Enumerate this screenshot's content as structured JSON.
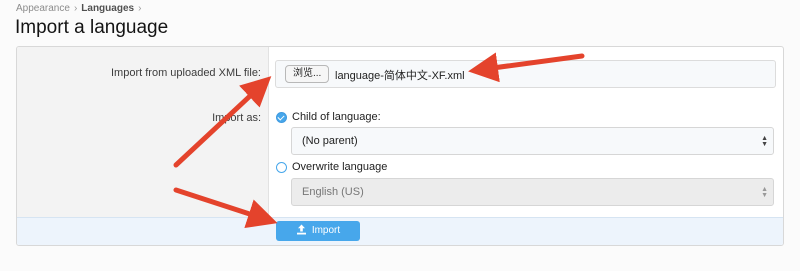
{
  "breadcrumb": {
    "items": [
      "Appearance",
      "Languages"
    ],
    "separator": "›"
  },
  "page": {
    "title": "Import a language"
  },
  "form": {
    "file_label": "Import from uploaded XML file:",
    "browse_label": "浏览...",
    "file_name": "language-简体中文-XF.xml",
    "import_as_label": "Import as:",
    "options": [
      {
        "label": "Child of language:",
        "checked": true,
        "select_value": "(No parent)",
        "disabled": false
      },
      {
        "label": "Overwrite language",
        "checked": false,
        "select_value": "English (US)",
        "disabled": true
      }
    ],
    "submit_label": "Import",
    "submit_icon": "upload-icon"
  },
  "colors": {
    "accent": "#47a7eb",
    "annotation_arrow": "#e4432c",
    "footer_bg": "#edf4fc"
  }
}
